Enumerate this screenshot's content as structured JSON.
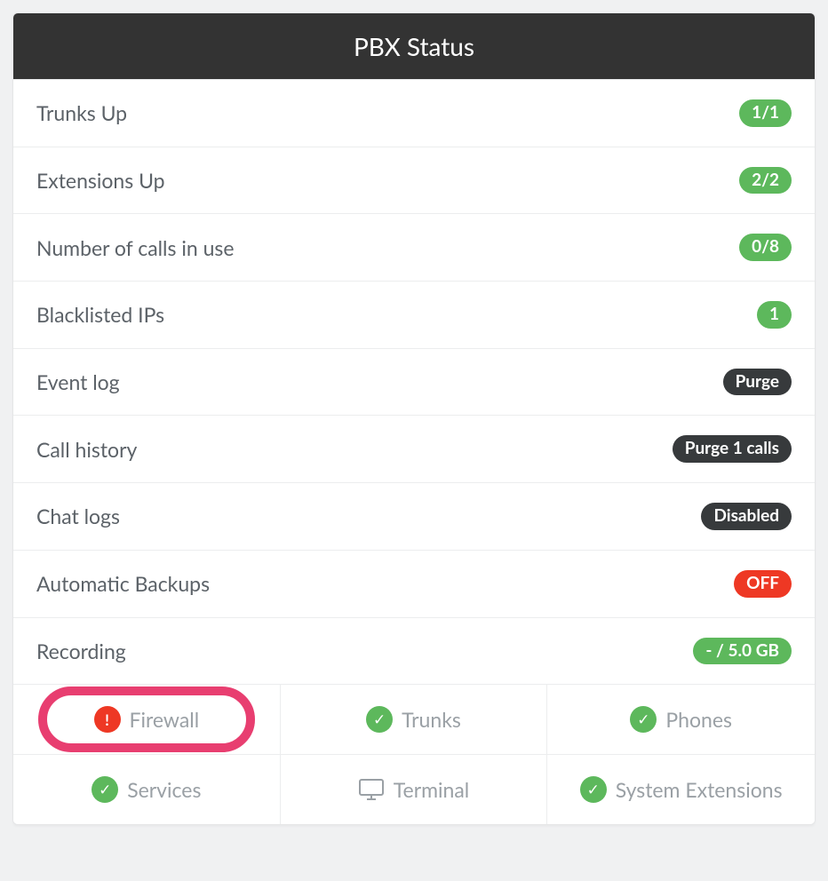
{
  "header": {
    "title": "PBX Status"
  },
  "rows": [
    {
      "label": "Trunks Up",
      "badge": "1/1",
      "badge_class": "green"
    },
    {
      "label": "Extensions Up",
      "badge": "2/2",
      "badge_class": "green"
    },
    {
      "label": "Number of calls in use",
      "badge": "0/8",
      "badge_class": "green"
    },
    {
      "label": "Blacklisted IPs",
      "badge": "1",
      "badge_class": "green"
    },
    {
      "label": "Event log",
      "badge": "Purge",
      "badge_class": "dark"
    },
    {
      "label": "Call history",
      "badge": "Purge 1 calls",
      "badge_class": "dark"
    },
    {
      "label": "Chat logs",
      "badge": "Disabled",
      "badge_class": "dark"
    },
    {
      "label": "Automatic Backups",
      "badge": "OFF",
      "badge_class": "red"
    },
    {
      "label": "Recording",
      "badge": "- / 5.0 GB",
      "badge_class": "green"
    }
  ],
  "tiles": [
    {
      "label": "Firewall",
      "status": "error",
      "highlighted": true
    },
    {
      "label": "Trunks",
      "status": "ok",
      "highlighted": false
    },
    {
      "label": "Phones",
      "status": "ok",
      "highlighted": false
    },
    {
      "label": "Services",
      "status": "ok",
      "highlighted": false
    },
    {
      "label": "Terminal",
      "status": "monitor",
      "highlighted": false
    },
    {
      "label": "System Extensions",
      "status": "ok",
      "highlighted": false
    }
  ]
}
